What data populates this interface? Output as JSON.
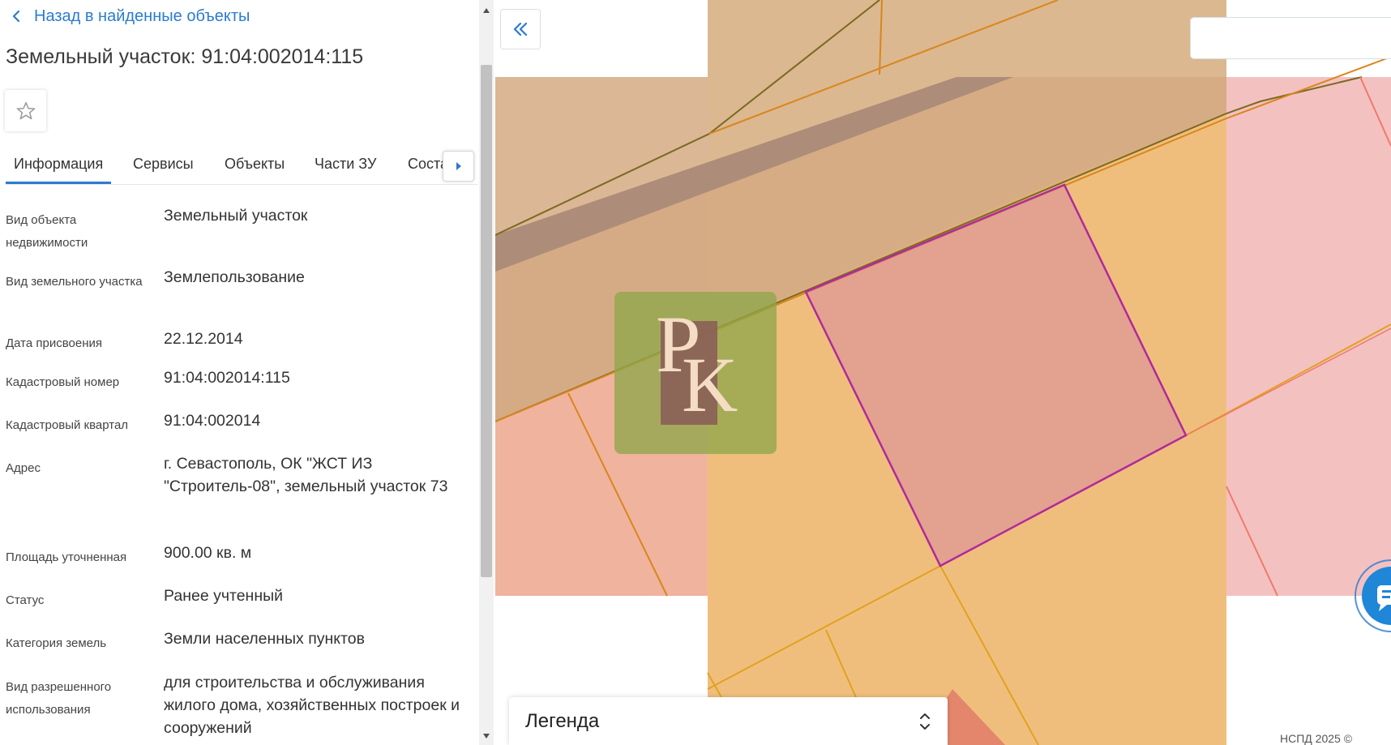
{
  "panel": {
    "back_label": "Назад в найденные объекты",
    "title": "Земельный участок: 91:04:002014:115",
    "tabs": [
      {
        "label": "Информация",
        "active": true
      },
      {
        "label": "Сервисы",
        "active": false
      },
      {
        "label": "Объекты",
        "active": false
      },
      {
        "label": "Части ЗУ",
        "active": false
      },
      {
        "label": "Соста",
        "active": false
      }
    ],
    "properties": [
      {
        "label": "Вид объекта недвижимости",
        "value": "Земельный участок"
      },
      {
        "label": "Вид земельного участка",
        "value": "Землепользование"
      },
      {
        "label": "Дата присвоения",
        "value": "22.12.2014"
      },
      {
        "label": "Кадастровый номер",
        "value": "91:04:002014:115"
      },
      {
        "label": "Кадастровый квартал",
        "value": "91:04:002014"
      },
      {
        "label": "Адрес",
        "value": "г. Севастополь, ОК \"ЖСТ ИЗ \"Строитель-08\", земельный участок 73"
      },
      {
        "label": "Площадь уточненная",
        "value": "900.00 кв. м"
      },
      {
        "label": "Статус",
        "value": "Ранее учтенный"
      },
      {
        "label": "Категория земель",
        "value": "Земли населенных пунктов"
      },
      {
        "label": "Вид разрешенного использования",
        "value": "для строительства и обслуживания жилого дома, хозяйственных построек и сооружений"
      }
    ]
  },
  "map": {
    "search_value": "",
    "search_placeholder": "",
    "legend_label": "Легенда",
    "copyright": "НСПД 2025 ©",
    "watermark_text": "PK"
  },
  "icons": {
    "back": "chevron-left-icon",
    "favorite": "star-outline-icon",
    "tab_scroll": "caret-right-icon",
    "collapse": "double-chevron-left-icon",
    "legend_toggle": "up-down-chevron-icon",
    "chat": "chat-bubble-icon"
  },
  "colors": {
    "accent": "#2b7bd0",
    "parcel_selected_border": "#b02a9a",
    "parcel_orange": "#f0be7c",
    "parcel_salmon": "#f0b39e",
    "parcel_pink": "#f4c1c1",
    "parcel_beige": "#e2cdb0",
    "watermark_green": "#8fa64a"
  }
}
